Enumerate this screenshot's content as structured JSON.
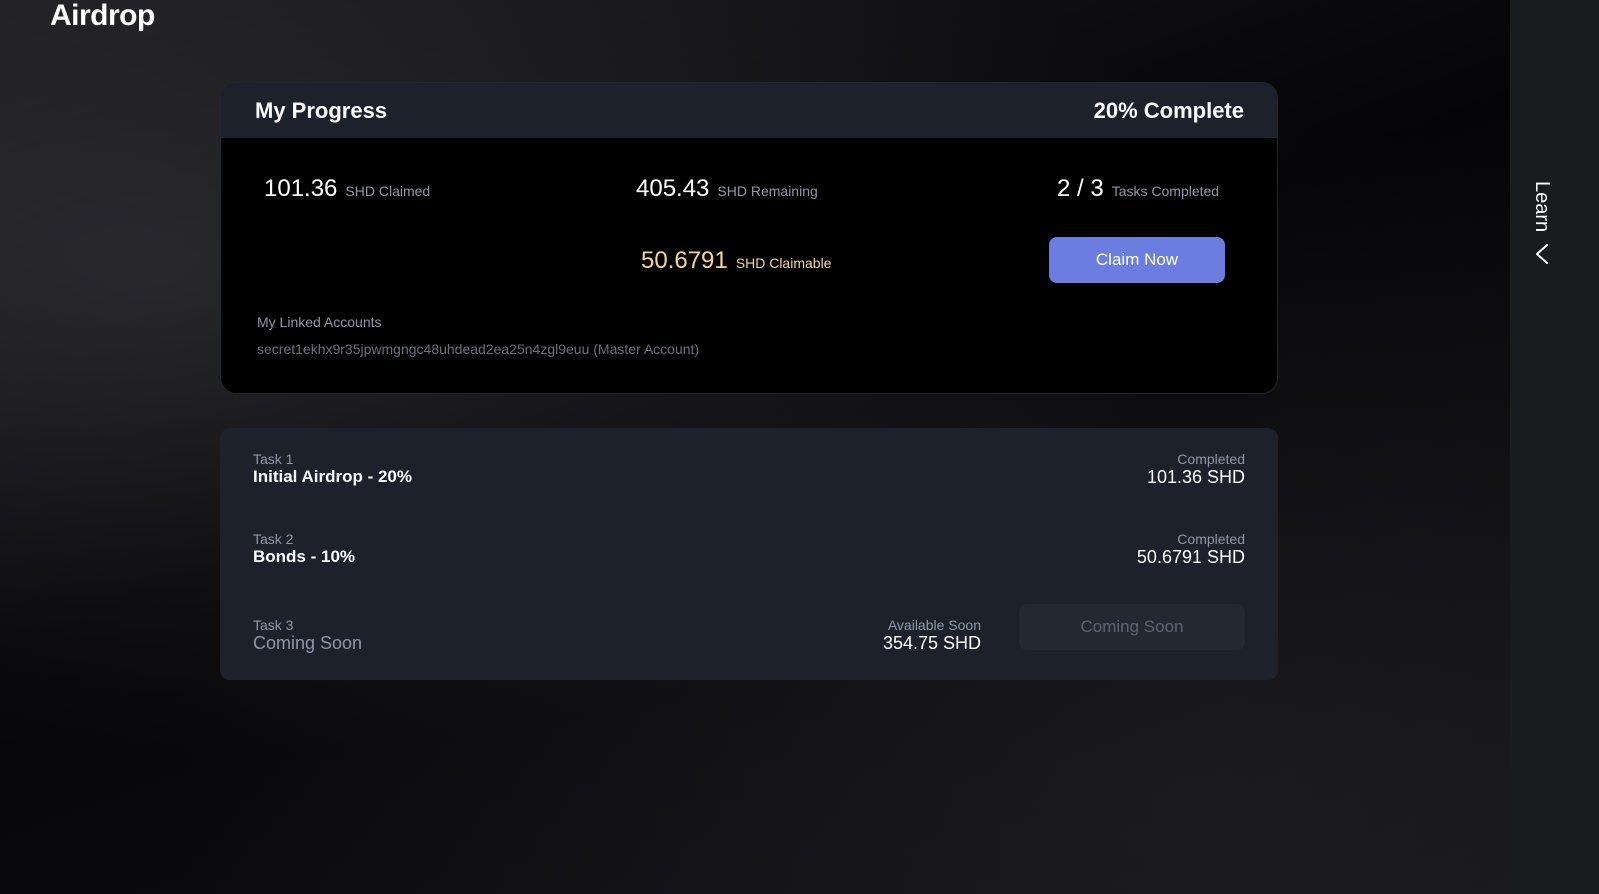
{
  "page": {
    "title": "Airdrop"
  },
  "progress": {
    "title": "My Progress",
    "complete_text": "20% Complete",
    "claimed": {
      "value": "101.36",
      "unit": "SHD Claimed"
    },
    "remaining": {
      "value": "405.43",
      "unit": "SHD Remaining"
    },
    "tasks_completed": {
      "value": "2 / 3",
      "unit": "Tasks Completed"
    },
    "claimable": {
      "value": "50.6791",
      "unit": "SHD Claimable"
    },
    "claim_button": "Claim Now",
    "linked_accounts_label": "My Linked Accounts",
    "linked_account": "secret1ekhx9r35jpwmgngc48uhdead2ea25n4zgl9euu (Master Account)"
  },
  "tasks": [
    {
      "label": "Task 1",
      "name": "Initial Airdrop - 20%",
      "status": "Completed",
      "amount": "101.36 SHD"
    },
    {
      "label": "Task 2",
      "name": "Bonds - 10%",
      "status": "Completed",
      "amount": "50.6791 SHD"
    },
    {
      "label": "Task 3",
      "name": "Coming Soon",
      "status": "Available Soon",
      "amount": "354.75 SHD",
      "button": "Coming Soon"
    }
  ],
  "sidebar": {
    "learn_label": "Learn",
    "chevron_icon": "chevron-left-icon"
  },
  "colors": {
    "accent": "#6b7ee0",
    "claimable": "#f5d98a",
    "card": "#1d212c"
  }
}
